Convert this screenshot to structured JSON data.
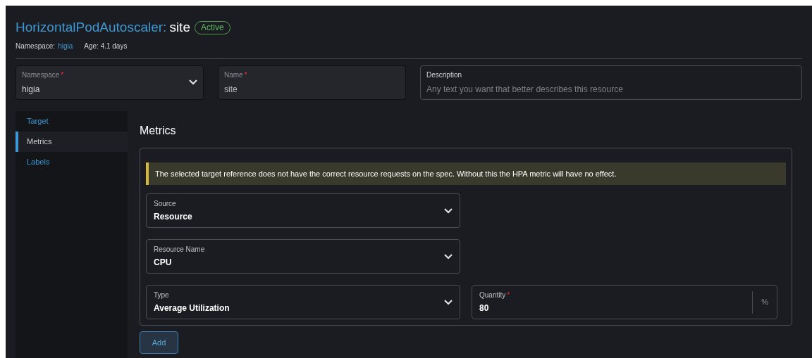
{
  "header": {
    "kind_label": "HorizontalPodAutoscaler:",
    "name": "site",
    "status": "Active",
    "namespace_label": "Namespace:",
    "namespace": "higia",
    "age": "Age: 4.1 days"
  },
  "top_fields": [
    {
      "kind": "select",
      "label": "Namespace",
      "required_mark": "*",
      "value": "higia"
    },
    {
      "kind": "input",
      "label": "Name",
      "required_mark": "*",
      "value": "site"
    },
    {
      "kind": "text",
      "label": "Description",
      "placeholder": "Any text you want that better describes this resource"
    }
  ],
  "sidebar": {
    "items": [
      {
        "label": "Target",
        "selected": false
      },
      {
        "label": "Metrics",
        "selected": true
      },
      {
        "label": "Labels",
        "selected": false
      }
    ]
  },
  "section_title": "Metrics",
  "banner": "The selected target reference does not have the correct resource requests on the spec. Without this the HPA metric will have no effect.",
  "metric_fields": [
    {
      "kind": "select",
      "label": "Source",
      "value": "Resource"
    },
    {
      "kind": "select",
      "label": "Resource Name",
      "value": "CPU"
    },
    {
      "kind": "select",
      "label": "Type",
      "value": "Average Utilization"
    },
    {
      "kind": "input",
      "label": "Quantity",
      "required_mark": "*",
      "value": "80",
      "suffix": "%"
    }
  ],
  "add_button": "Add"
}
